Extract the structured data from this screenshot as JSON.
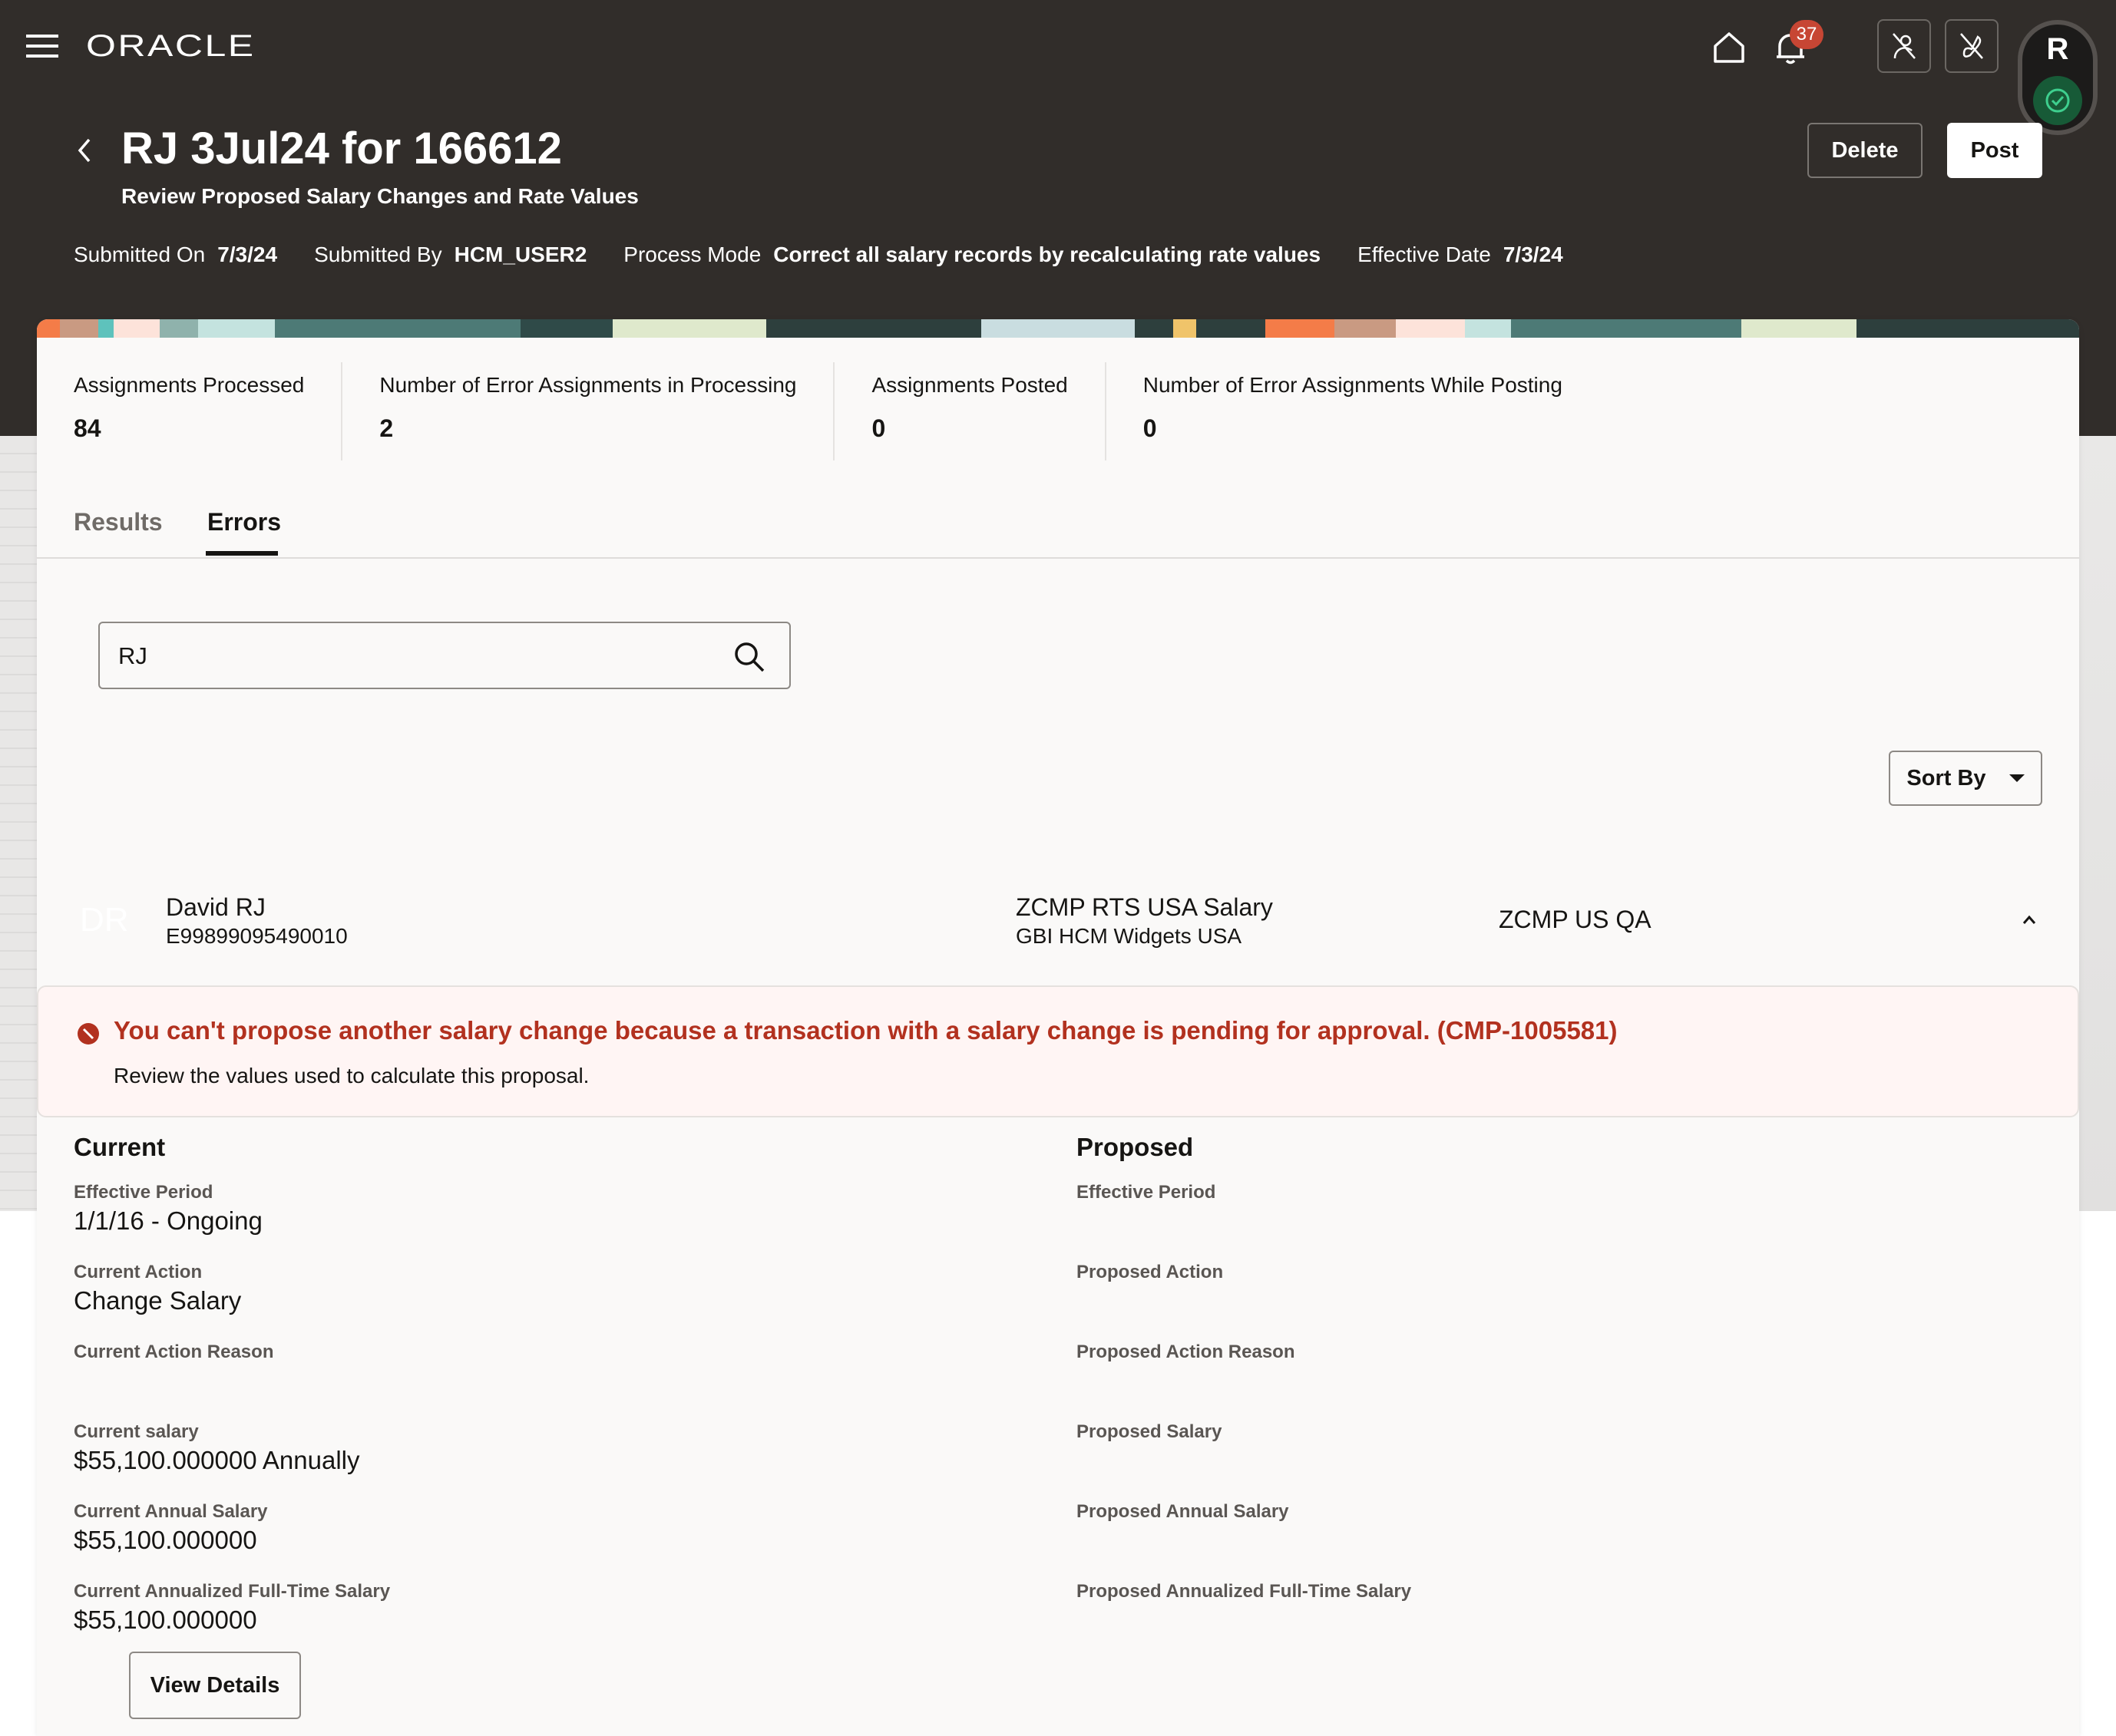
{
  "topbar": {
    "brand": "ORACLE",
    "notification_count": "37",
    "icons": [
      "menu-icon",
      "home-icon",
      "bell-icon",
      "access-off-icon",
      "edit-off-icon",
      "assistant-icon"
    ]
  },
  "header": {
    "title": "RJ 3Jul24 for 166612",
    "subtitle": "Review Proposed Salary Changes and Rate Values",
    "delete_label": "Delete",
    "post_label": "Post",
    "meta": [
      {
        "label": "Submitted On",
        "value": "7/3/24"
      },
      {
        "label": "Submitted By",
        "value": "HCM_USER2"
      },
      {
        "label": "Process Mode",
        "value": "Correct all salary records by recalculating rate values"
      },
      {
        "label": "Effective Date",
        "value": "7/3/24"
      }
    ]
  },
  "stats": [
    {
      "label": "Assignments Processed",
      "value": "84"
    },
    {
      "label": "Number of Error Assignments in Processing",
      "value": "2"
    },
    {
      "label": "Assignments Posted",
      "value": "0"
    },
    {
      "label": "Number of Error Assignments While Posting",
      "value": "0"
    }
  ],
  "tabs": [
    {
      "label": "Results",
      "active": false
    },
    {
      "label": "Errors",
      "active": true
    }
  ],
  "search": {
    "value": "RJ",
    "placeholder": ""
  },
  "sort": {
    "label": "Sort By"
  },
  "row": {
    "initials": "DR",
    "name": "David RJ",
    "id": "E99899095490010",
    "plan": "ZCMP RTS USA Salary",
    "org": "GBI HCM Widgets USA",
    "group": "ZCMP US QA"
  },
  "error": {
    "title": "You can't propose another salary change because a transaction with a salary change is pending for approval. (CMP-1005581)",
    "subtitle": "Review the values used to calculate this proposal.",
    "color": "#b2311f"
  },
  "current": {
    "title": "Current",
    "fields": [
      {
        "label": "Effective Period",
        "value": "1/1/16 - Ongoing"
      },
      {
        "label": "Current Action",
        "value": "Change Salary"
      },
      {
        "label": "Current Action Reason",
        "value": ""
      },
      {
        "label": "Current salary",
        "value": "$55,100.000000 Annually"
      },
      {
        "label": "Current Annual Salary",
        "value": "$55,100.000000"
      },
      {
        "label": "Current Annualized Full-Time Salary",
        "value": "$55,100.000000"
      }
    ]
  },
  "proposed": {
    "title": "Proposed",
    "fields": [
      {
        "label": "Effective Period",
        "value": ""
      },
      {
        "label": "Proposed Action",
        "value": ""
      },
      {
        "label": "Proposed Action Reason",
        "value": ""
      },
      {
        "label": "Proposed Salary",
        "value": ""
      },
      {
        "label": "Proposed Annual Salary",
        "value": ""
      },
      {
        "label": "Proposed Annualized Full-Time Salary",
        "value": ""
      }
    ]
  },
  "view_details_label": "View Details"
}
